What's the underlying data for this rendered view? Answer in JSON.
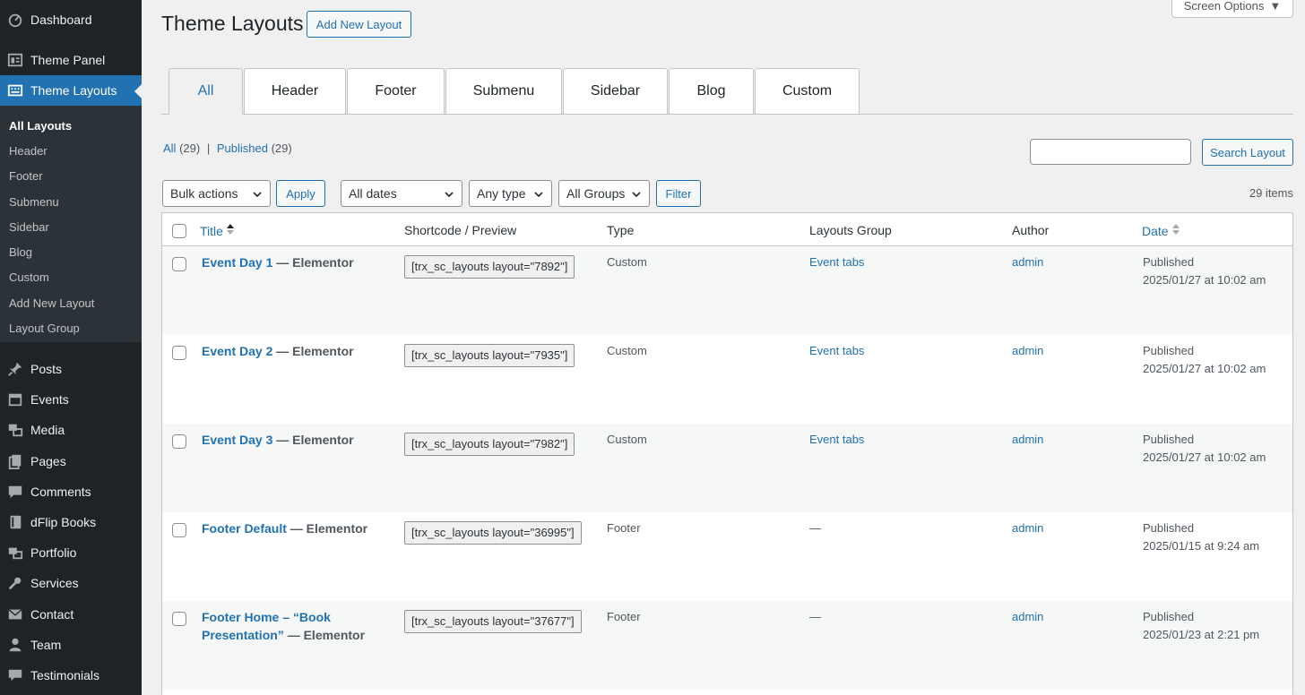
{
  "sidebar": {
    "items": [
      {
        "label": "Dashboard",
        "icon": "dashboard-icon"
      },
      {
        "label": "Theme Panel",
        "icon": "theme-panel-icon"
      },
      {
        "label": "Theme Layouts",
        "icon": "layouts-icon"
      },
      {
        "label": "Posts",
        "icon": "pin-icon"
      },
      {
        "label": "Events",
        "icon": "calendar-icon"
      },
      {
        "label": "Media",
        "icon": "media-icon"
      },
      {
        "label": "Pages",
        "icon": "pages-icon"
      },
      {
        "label": "Comments",
        "icon": "comment-icon"
      },
      {
        "label": "dFlip Books",
        "icon": "book-icon"
      },
      {
        "label": "Portfolio",
        "icon": "portfolio-icon"
      },
      {
        "label": "Services",
        "icon": "wrench-icon"
      },
      {
        "label": "Contact",
        "icon": "envelope-icon"
      },
      {
        "label": "Team",
        "icon": "user-icon"
      },
      {
        "label": "Testimonials",
        "icon": "speech-bubble-icon"
      }
    ],
    "submenu": [
      "All Layouts",
      "Header",
      "Footer",
      "Submenu",
      "Sidebar",
      "Blog",
      "Custom",
      "Add New Layout",
      "Layout Group"
    ]
  },
  "header": {
    "title": "Theme Layouts",
    "add_new": "Add New Layout",
    "screen_options": "Screen Options"
  },
  "tabs": [
    "All",
    "Header",
    "Footer",
    "Submenu",
    "Sidebar",
    "Blog",
    "Custom"
  ],
  "views": {
    "all_label": "All",
    "all_count": "(29)",
    "separator": "|",
    "published_label": "Published",
    "published_count": "(29)"
  },
  "search": {
    "value": "",
    "button": "Search Layout"
  },
  "filters": {
    "bulk_actions": "Bulk actions",
    "apply": "Apply",
    "dates": "All dates",
    "type": "Any type",
    "groups": "All Groups",
    "filter": "Filter",
    "items_count": "29 items"
  },
  "table": {
    "columns": {
      "title": "Title",
      "shortcode": "Shortcode / Preview",
      "type": "Type",
      "group": "Layouts Group",
      "author": "Author",
      "date": "Date"
    },
    "rows": [
      {
        "title": "Event Day 1",
        "suffix": " — Elementor",
        "shortcode": "[trx_sc_layouts layout=\"7892\"]",
        "type": "Custom",
        "group": "Event tabs",
        "author": "admin",
        "status": "Published",
        "date": "2025/01/27 at 10:02 am"
      },
      {
        "title": "Event Day 2",
        "suffix": " — Elementor",
        "shortcode": "[trx_sc_layouts layout=\"7935\"]",
        "type": "Custom",
        "group": "Event tabs",
        "author": "admin",
        "status": "Published",
        "date": "2025/01/27 at 10:02 am"
      },
      {
        "title": "Event Day 3",
        "suffix": " — Elementor",
        "shortcode": "[trx_sc_layouts layout=\"7982\"]",
        "type": "Custom",
        "group": "Event tabs",
        "author": "admin",
        "status": "Published",
        "date": "2025/01/27 at 10:02 am"
      },
      {
        "title": "Footer Default",
        "suffix": " — Elementor",
        "shortcode": "[trx_sc_layouts layout=\"36995\"]",
        "type": "Footer",
        "group": "—",
        "author": "admin",
        "status": "Published",
        "date": "2025/01/15 at 9:24 am"
      },
      {
        "title": "Footer Home – “Book Presentation”",
        "suffix": " — Elementor",
        "shortcode": "[trx_sc_layouts layout=\"37677\"]",
        "type": "Footer",
        "group": "—",
        "author": "admin",
        "status": "Published",
        "date": "2025/01/23 at 2:21 pm"
      }
    ]
  }
}
